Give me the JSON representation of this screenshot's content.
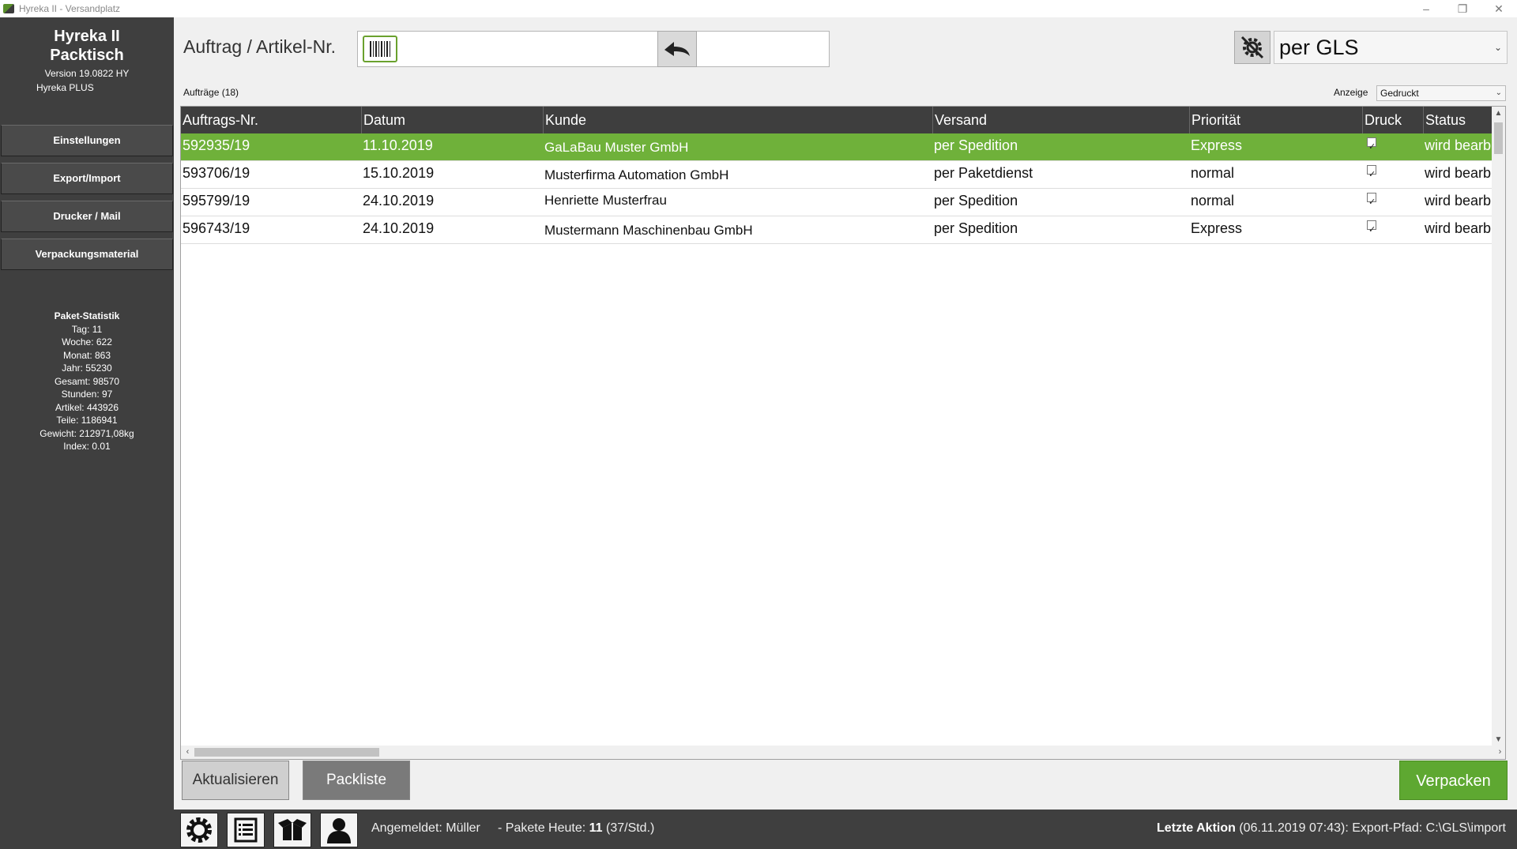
{
  "window": {
    "title": "Hyreka II - Versandplatz",
    "controls": [
      "–",
      "❐",
      "✕"
    ]
  },
  "sidebar": {
    "app_name_line1": "Hyreka II",
    "app_name_line2": "Packtisch",
    "version": "Version 19.0822 HY",
    "edition": "Hyreka PLUS",
    "buttons": [
      "Einstellungen",
      "Export/Import",
      "Drucker / Mail",
      "Verpackungsmaterial"
    ],
    "stats": {
      "title": "Paket-Statistik",
      "lines": [
        "Tag: 11",
        "Woche: 622",
        "Monat: 863",
        "Jahr: 55230",
        "Gesamt: 98570",
        "Stunden: 97",
        "Artikel: 443926",
        "Teile: 1186941",
        "Gewicht: 212971,08kg",
        "Index: 0.01"
      ]
    }
  },
  "header": {
    "search_label": "Auftrag / Artikel-Nr.",
    "search_value": "",
    "carrier": "per GLS"
  },
  "list": {
    "count_label": "Aufträge (18)",
    "filter_label": "Anzeige",
    "filter_value": "Gedruckt",
    "columns": [
      "Auftrags-Nr.",
      "Datum",
      "Kunde",
      "Versand",
      "Priorität",
      "Druck",
      "Status"
    ],
    "rows": [
      {
        "nr": "592935/19",
        "datum": "11.10.2019",
        "kunde": "GaLaBau Muster GmbH",
        "versand": "per Spedition",
        "prio": "Express",
        "druck": true,
        "status": "wird bearb"
      },
      {
        "nr": "593706/19",
        "datum": "15.10.2019",
        "kunde": "Musterfirma Automation GmbH",
        "versand": "per Paketdienst",
        "prio": "normal",
        "druck": true,
        "status": "wird bearb"
      },
      {
        "nr": "595799/19",
        "datum": "24.10.2019",
        "kunde": "Henriette Musterfrau",
        "versand": "per Spedition",
        "prio": "normal",
        "druck": true,
        "status": "wird bearb"
      },
      {
        "nr": "596743/19",
        "datum": "24.10.2019",
        "kunde": "Mustermann Maschinenbau GmbH",
        "versand": "per Spedition",
        "prio": "Express",
        "druck": true,
        "status": "wird bearb"
      }
    ]
  },
  "actions": {
    "refresh": "Aktualisieren",
    "packlist": "Packliste",
    "pack": "Verpacken"
  },
  "statusbar": {
    "logged_in": "Angemeldet: Müller",
    "pakete_prefix": "- Pakete Heute: ",
    "pakete_count": "11",
    "pakete_rate": " (37/Std.)",
    "last_action_label": "Letzte Aktion",
    "last_action_text": " (06.11.2019 07:43): Export-Pfad: C:\\GLS\\import"
  },
  "colors": {
    "sidebar_bg": "#3f3f3f",
    "accent_green": "#6fb13a",
    "button_green": "#5ea831",
    "header_bg": "#3e3e3e"
  },
  "icons": [
    "app-icon",
    "barcode-icon",
    "back-arrow-icon",
    "settings-disabled-icon",
    "gear-icon",
    "list-icon",
    "package-icon",
    "user-icon"
  ]
}
